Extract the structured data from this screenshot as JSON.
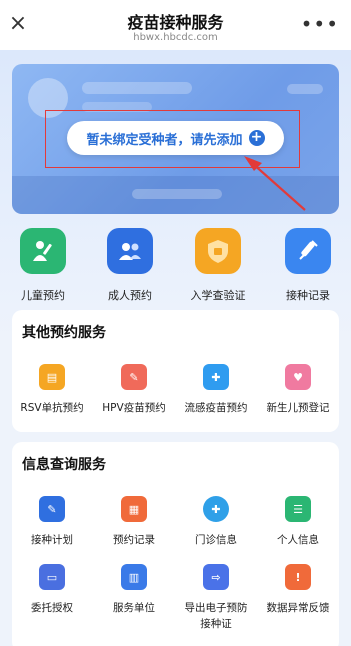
{
  "header": {
    "title": "疫苗接种服务",
    "domain": "hbwx.hbcdc.com",
    "close_glyph": "×",
    "more_glyph": "•••"
  },
  "card": {
    "add_prompt": "暂未绑定受种者，请先添加",
    "plus_glyph": "+"
  },
  "quick_actions": [
    {
      "label": "儿童预约",
      "icon": "child-vaccine-icon",
      "color": "#2bb673"
    },
    {
      "label": "成人预约",
      "icon": "adult-users-icon",
      "color": "#2f6fe0"
    },
    {
      "label": "入学查验证",
      "icon": "school-badge-icon",
      "color": "#f5a623"
    },
    {
      "label": "接种记录",
      "icon": "syringe-icon",
      "color": "#3a86f0"
    }
  ],
  "other_services": {
    "title": "其他预约服务",
    "items": [
      {
        "label": "RSV单抗预约",
        "icon": "rsv-icon",
        "color": "#f5a623"
      },
      {
        "label": "HPV疫苗预约",
        "icon": "hpv-icon",
        "color": "#f06a5a"
      },
      {
        "label": "流感疫苗预约",
        "icon": "flu-icon",
        "color": "#2f9cf0"
      },
      {
        "label": "新生儿预登记",
        "icon": "newborn-icon",
        "color": "#f07aa0"
      }
    ]
  },
  "info_services": {
    "title": "信息查询服务",
    "items": [
      {
        "label": "接种计划",
        "icon": "plan-icon",
        "color": "#2f6fe0"
      },
      {
        "label": "预约记录",
        "icon": "record-icon",
        "color": "#f06a3a"
      },
      {
        "label": "门诊信息",
        "icon": "clinic-icon",
        "color": "#2fa0e8"
      },
      {
        "label": "个人信息",
        "icon": "id-card-icon",
        "color": "#2bb673"
      },
      {
        "label": "委托授权",
        "icon": "authorize-icon",
        "color": "#4a6fe0"
      },
      {
        "label": "服务单位",
        "icon": "building-icon",
        "color": "#3a7ae8"
      },
      {
        "label": "导出电子预防接种证",
        "icon": "export-icon",
        "color": "#4a72e8"
      },
      {
        "label": "数据异常反馈",
        "icon": "feedback-icon",
        "color": "#f06a3a"
      }
    ]
  }
}
